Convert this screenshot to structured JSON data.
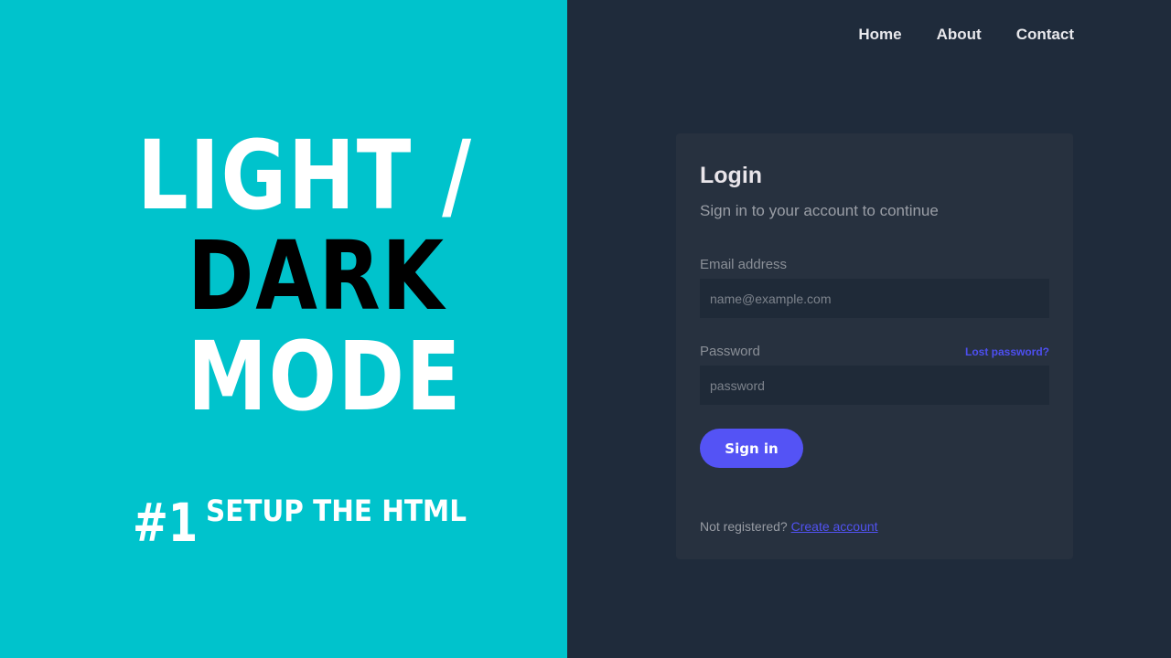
{
  "thumbnail": {
    "line1": "LIGHT /",
    "line2": "DARK",
    "line3": "MODE",
    "episode": "#1",
    "subtitle": "SETUP THE HTML"
  },
  "nav": {
    "items": [
      "Home",
      "About",
      "Contact"
    ]
  },
  "login": {
    "title": "Login",
    "subtitle": "Sign in to your account to continue",
    "email_label": "Email address",
    "email_placeholder": "name@example.com",
    "password_label": "Password",
    "password_placeholder": "password",
    "lost_password": "Lost password?",
    "sign_in": "Sign in",
    "not_registered": "Not registered?",
    "create_account": "Create account"
  },
  "colors": {
    "left_bg": "#00c3cc",
    "right_bg": "#1f2b3b",
    "card_bg": "#27313f",
    "accent": "#5453f5"
  }
}
